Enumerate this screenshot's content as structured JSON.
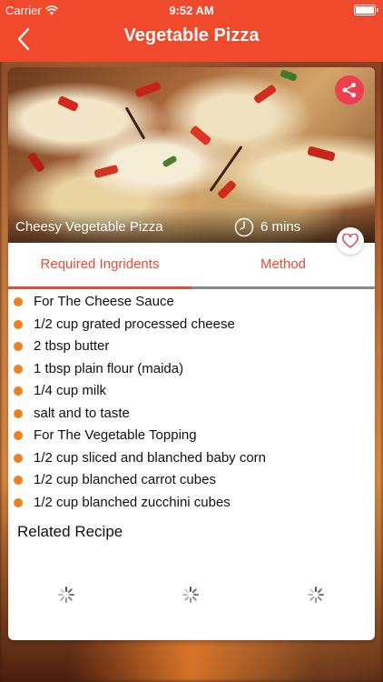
{
  "status_bar": {
    "carrier": "Carrier",
    "time": "9:52 AM"
  },
  "nav": {
    "title": "Vegetable Pizza"
  },
  "recipe": {
    "caption": "Cheesy Vegetable Pizza",
    "time": "6 mins"
  },
  "tabs": [
    {
      "label": "Required Ingridents",
      "active": true
    },
    {
      "label": "Method",
      "active": false
    }
  ],
  "ingredients": [
    "For The Cheese Sauce",
    "1/2 cup grated processed cheese",
    "2 tbsp butter",
    "1 tbsp plain flour (maida)",
    "1/4 cup milk",
    "salt and to taste",
    "For The Vegetable Topping",
    "1/2 cup sliced and blanched baby corn",
    "1/2 cup blanched carrot cubes",
    "1/2 cup blanched zucchini cubes"
  ],
  "related": {
    "title": "Related Recipe"
  },
  "colors": {
    "accent": "#f0492c",
    "bullet": "#f07f1d",
    "share": "#ef3f4e"
  },
  "icons": {
    "back": "chevron-left-icon",
    "share": "share-icon",
    "clock": "clock-icon",
    "favorite": "heart-icon",
    "loading": "spinner-icon",
    "wifi": "wifi-icon",
    "battery": "battery-icon"
  }
}
